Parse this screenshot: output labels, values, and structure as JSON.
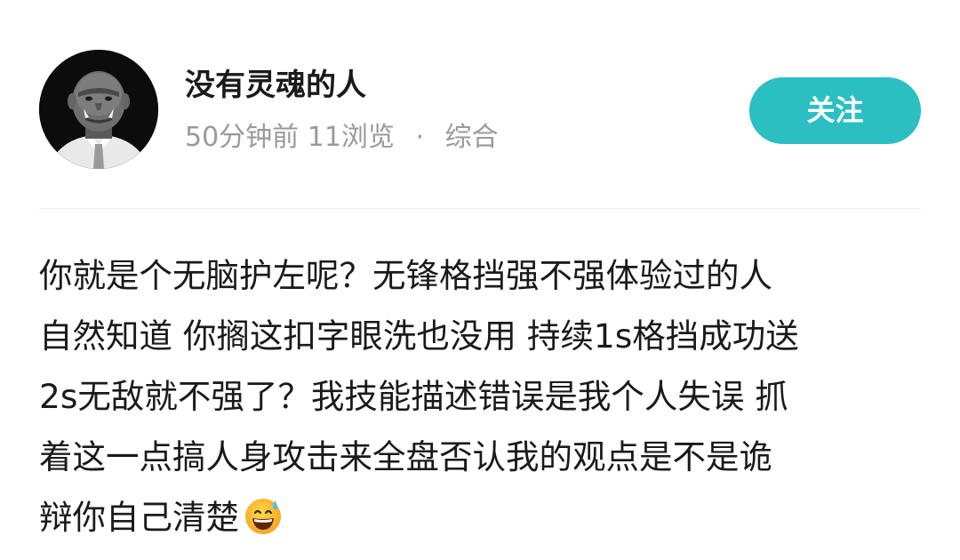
{
  "author": {
    "name": "没有灵魂的人",
    "avatar_icon": "orc-in-suit-avatar"
  },
  "meta": {
    "time": "50分钟前",
    "views": "11浏览",
    "separator": "·",
    "category": "综合"
  },
  "follow_button": {
    "label": "关注",
    "color": "#2bbfc2"
  },
  "post": {
    "lines": [
      "你就是个无脑护左呢？无锋格挡强不强体验过的人",
      "自然知道 你搁这扣字眼洗也没用 持续1s格挡成功送",
      "2s无敌就不强了？我技能描述错误是我个人失误 抓",
      "着这一点搞人身攻击来全盘否认我的观点是不是诡",
      "辩你自己清楚"
    ],
    "trailing_emoji": "grinning-face-with-sweat-emoji"
  }
}
